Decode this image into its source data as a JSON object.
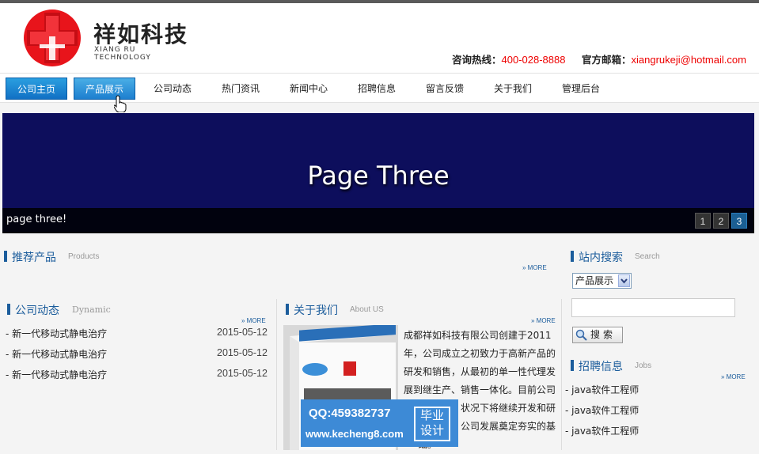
{
  "header": {
    "brand_cn": "祥如科技",
    "brand_en": "XIANG RU TECHNOLOGY",
    "hotline_label": "咨询热线：",
    "hotline_value": "400-028-8888",
    "email_label": "官方邮箱：",
    "email_value": "xiangrukeji@hotmail.com",
    "accent_color": "#e00000"
  },
  "nav": {
    "items": [
      {
        "label": "公司主页"
      },
      {
        "label": "产品展示"
      },
      {
        "label": "公司动态"
      },
      {
        "label": "热门资讯"
      },
      {
        "label": "新闻中心"
      },
      {
        "label": "招聘信息"
      },
      {
        "label": "留言反馈"
      },
      {
        "label": "关于我们"
      },
      {
        "label": "管理后台"
      }
    ],
    "active_color": "#1170c4"
  },
  "banner": {
    "title": "Page Three",
    "caption": "page three!",
    "pages": [
      "1",
      "2",
      "3"
    ],
    "current_page": 3,
    "background": "#0d0e5c"
  },
  "products": {
    "title": "推荐产品",
    "title_en": "Products",
    "more": "» MORE"
  },
  "news": {
    "title": "公司动态",
    "title_en": "Dynamic",
    "more": "» MORE",
    "items": [
      {
        "text": "- 新一代移动式静电治疗",
        "date": "2015-05-12"
      },
      {
        "text": "- 新一代移动式静电治疗",
        "date": "2015-05-12"
      },
      {
        "text": "- 新一代移动式静电治疗",
        "date": "2015-05-12"
      }
    ]
  },
  "about": {
    "title": "关于我们",
    "title_en": "About US",
    "more": "» MORE",
    "lines": [
      "成都祥如科技有限公司创建于2011",
      "年，公司成立之初致力于高新产品的",
      "研发和销售，从最初的单一性代理发",
      "展到继生产、销售一体化。目前公司",
      "状况下将继续开发和研",
      "公司发展奠定夯实的基",
      "础。"
    ]
  },
  "search": {
    "title": "站内搜索",
    "title_en": "Search",
    "selected_option": "产品展示",
    "button_label": "搜索"
  },
  "jobs": {
    "title": "招聘信息",
    "title_en": "Jobs",
    "more": "» MORE",
    "items": [
      "- java软件工程师",
      "- java软件工程师",
      "- java软件工程师"
    ]
  },
  "watermark": {
    "qq": "QQ:459382737",
    "url": "www.kecheng8.com",
    "badge_line1": "毕业",
    "badge_line2": "设计"
  }
}
